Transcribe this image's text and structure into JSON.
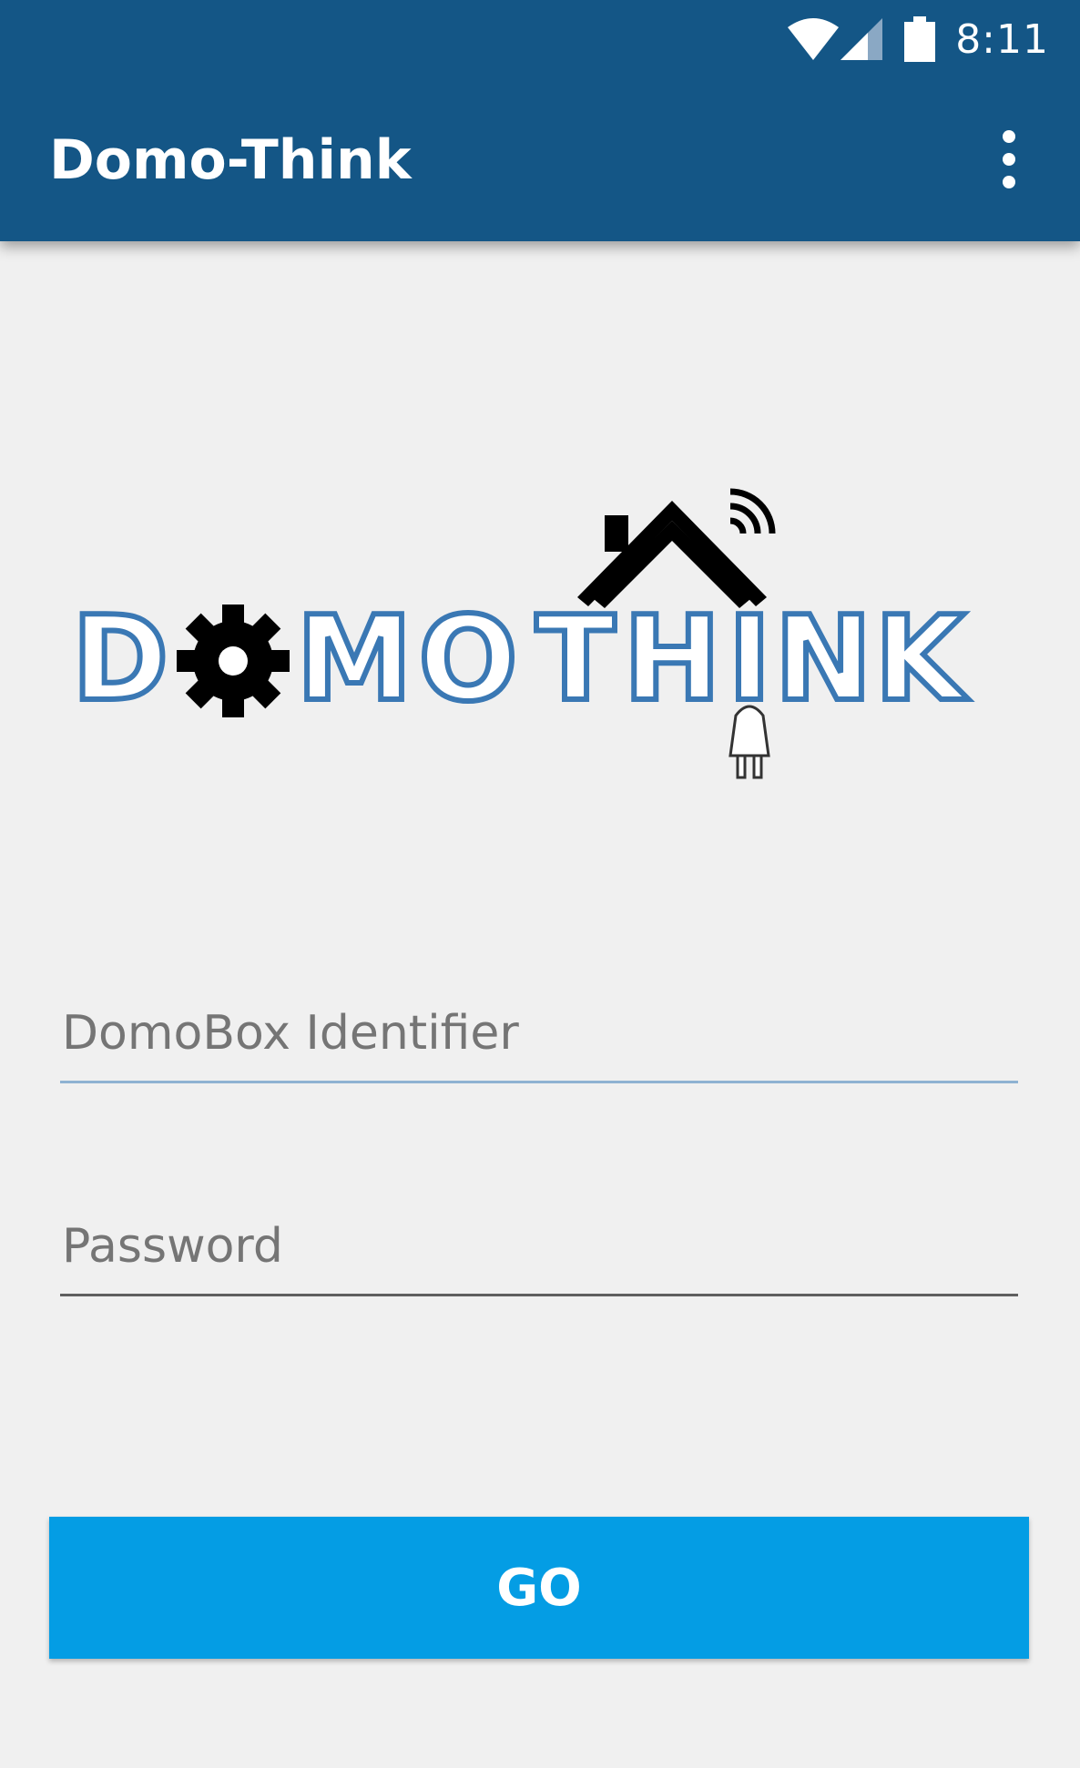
{
  "status_bar": {
    "time": "8:11",
    "icons": [
      "wifi-icon",
      "signal-icon",
      "battery-icon"
    ]
  },
  "app_bar": {
    "title": "Domo-Think",
    "overflow_icon": "more-vert-icon"
  },
  "logo": {
    "text": "DOMOTHINK",
    "icons": [
      "gear-icon",
      "house-roof-icon",
      "wireless-signal-icon",
      "plug-icon"
    ]
  },
  "form": {
    "identifier_placeholder": "DomoBox Identifier",
    "password_placeholder": "Password",
    "go_label": "GO"
  },
  "colors": {
    "app_bar": "#145686",
    "background": "#f0f0f0",
    "button": "#049de4",
    "logo_outline": "#3a78b4"
  }
}
